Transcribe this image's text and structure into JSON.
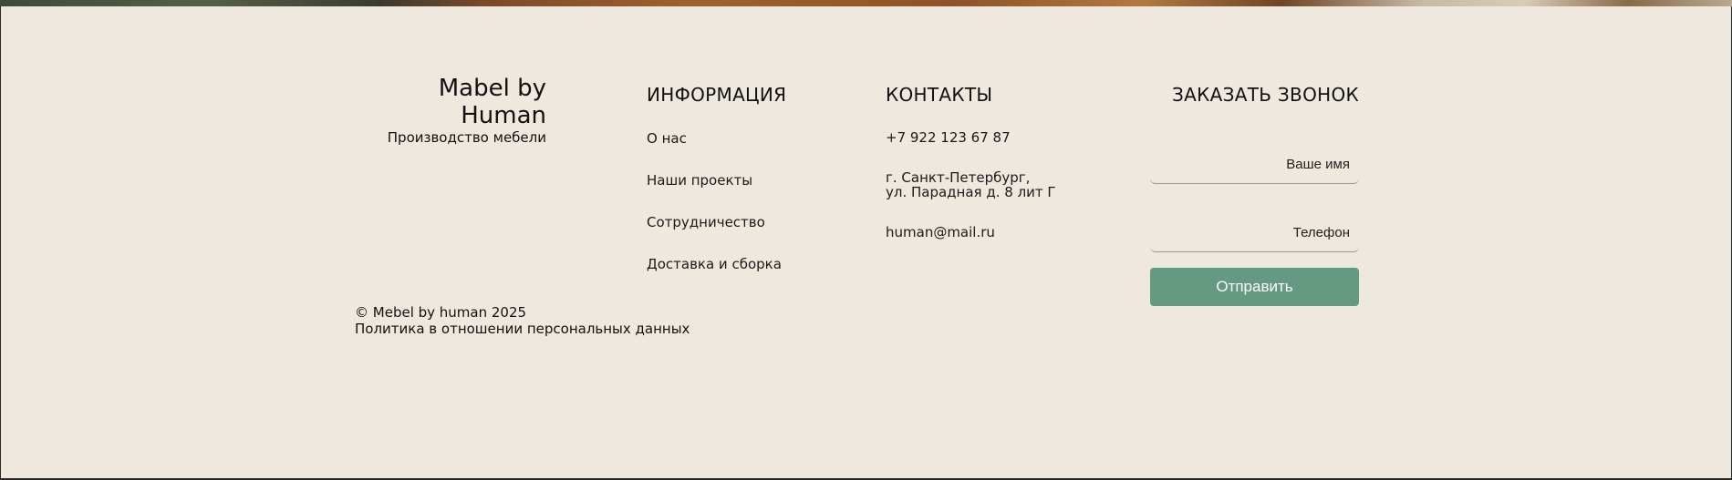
{
  "brand": {
    "name": "Mabel by Human",
    "tagline": "Производство мебели"
  },
  "info": {
    "title": "ИНФОРМАЦИЯ",
    "links": [
      "О нас",
      "Наши проекты",
      "Сотрудничество",
      "Доставка и сборка"
    ]
  },
  "contacts": {
    "title": "КОНТАКТЫ",
    "phone": "+7 922 123 67 87",
    "address_line1": "г. Санкт-Петербург,",
    "address_line2": "ул. Парадная д. 8 лит Г",
    "email": "human@mail.ru"
  },
  "callback": {
    "title": "ЗАКАЗАТЬ ЗВОНОК",
    "name_placeholder": "Ваше имя",
    "phone_placeholder": "Телефон",
    "submit_label": "Отправить",
    "accent_color": "#659a82"
  },
  "legal": {
    "copyright": "© Mebel by human 2025",
    "privacy": "Политика в отношении персональных данных"
  }
}
